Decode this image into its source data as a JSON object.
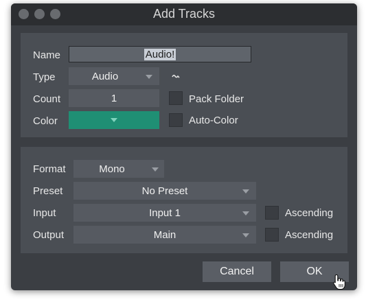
{
  "window": {
    "title": "Add Tracks"
  },
  "general": {
    "name_label": "Name",
    "name_value": "Audio!",
    "type_label": "Type",
    "type_value": "Audio",
    "count_label": "Count",
    "count_value": "1",
    "pack_folder_label": "Pack Folder",
    "color_label": "Color",
    "color_value": "#1f8f74",
    "auto_color_label": "Auto-Color"
  },
  "routing": {
    "format_label": "Format",
    "format_value": "Mono",
    "preset_label": "Preset",
    "preset_value": "No Preset",
    "input_label": "Input",
    "input_value": "Input 1",
    "input_ascending_label": "Ascending",
    "output_label": "Output",
    "output_value": "Main",
    "output_ascending_label": "Ascending"
  },
  "buttons": {
    "cancel": "Cancel",
    "ok": "OK"
  },
  "icons": {
    "type_extra": "waveform-icon",
    "cursor": "hand-pointer-icon"
  }
}
